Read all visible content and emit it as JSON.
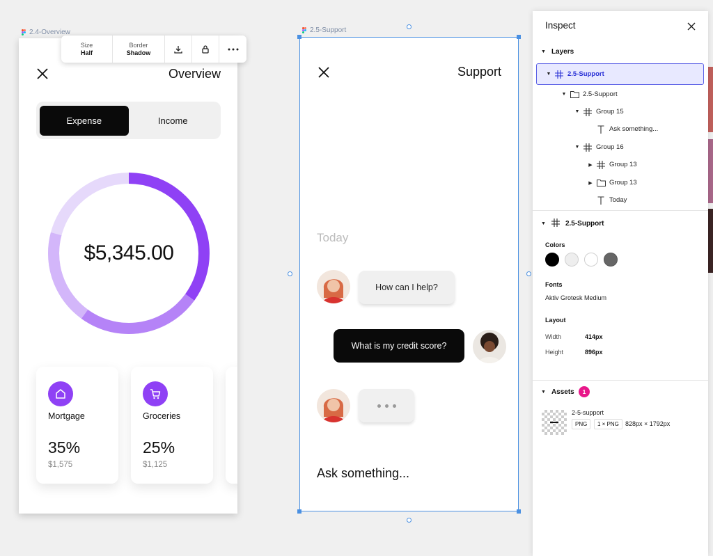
{
  "canvas": {
    "frame1_label": "2.4-Overview",
    "frame2_label": "2.5-Support"
  },
  "toolbar": {
    "size_key": "Size",
    "size_value": "Half",
    "border_key": "Border",
    "border_value": "Shadow",
    "download_icon": "download-icon",
    "lock_icon": "lock-icon",
    "more_icon": "more-icon"
  },
  "overview": {
    "title": "Overview",
    "tabs": [
      {
        "label": "Expense",
        "active": true
      },
      {
        "label": "Income",
        "active": false
      }
    ],
    "total_amount": "$5,345.00",
    "accent_color": "#8f41f5",
    "cards": [
      {
        "icon": "home-icon",
        "name": "Mortgage",
        "percent": "35%",
        "amount": "$1,575"
      },
      {
        "icon": "cart-icon",
        "name": "Groceries",
        "percent": "25%",
        "amount": "$1,125"
      }
    ]
  },
  "support": {
    "title": "Support",
    "day_label": "Today",
    "messages": [
      {
        "from": "agent",
        "text": "How can I help?"
      },
      {
        "from": "user",
        "text": "What is my credit score?"
      },
      {
        "from": "agent",
        "text": "",
        "typing": true
      }
    ],
    "input_placeholder": "Ask something..."
  },
  "inspect": {
    "title": "Inspect",
    "layers_heading": "Layers",
    "layers": [
      {
        "label": "2.5-Support",
        "icon": "frame-icon",
        "selected": true
      },
      {
        "label": "2.5-Support",
        "icon": "folder-icon"
      },
      {
        "label": "Group 15",
        "icon": "frame-icon"
      },
      {
        "label": "Ask something...",
        "icon": "text-icon"
      },
      {
        "label": "Group 16",
        "icon": "frame-icon"
      },
      {
        "label": "Group 13",
        "icon": "frame-icon"
      },
      {
        "label": "Group 13",
        "icon": "folder-icon"
      },
      {
        "label": "Today",
        "icon": "text-icon"
      }
    ],
    "frame_heading": "2.5-Support",
    "colors_label": "Colors",
    "colors": [
      "#000000",
      "#eeeeee",
      "#ffffff",
      "#666666"
    ],
    "fonts_label": "Fonts",
    "font_name": "Aktiv Grotesk Medium",
    "layout_label": "Layout",
    "width_key": "Width",
    "width_value": "414px",
    "height_key": "Height",
    "height_value": "896px",
    "assets_heading": "Assets",
    "assets_count": "1",
    "asset_name": "2-5-support",
    "asset_format": "PNG",
    "asset_scale": "1 × PNG",
    "asset_dims": "828px × 1792px"
  }
}
